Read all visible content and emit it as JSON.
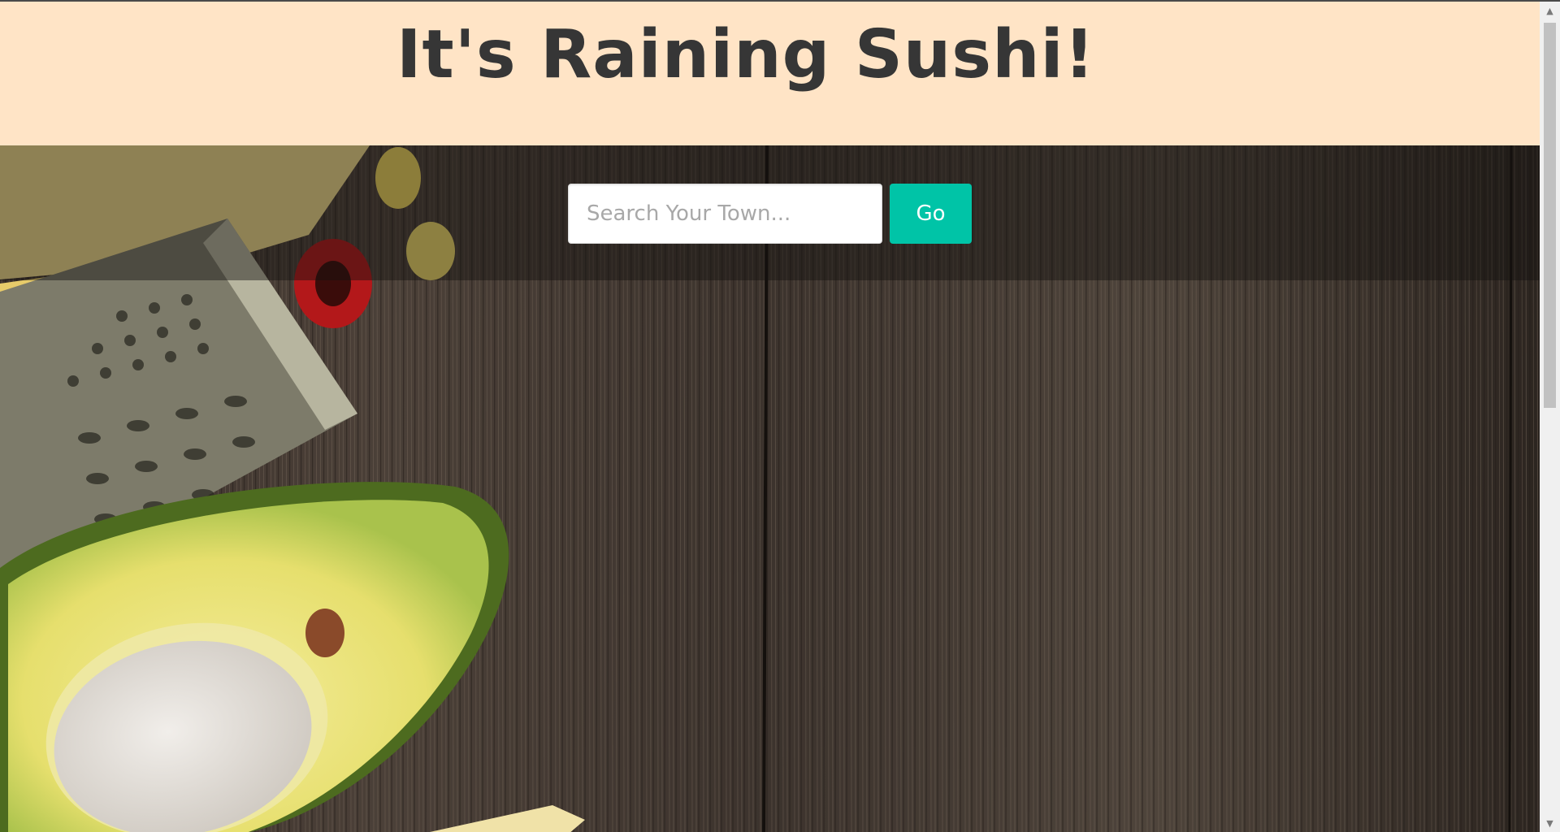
{
  "header": {
    "title": "It's Raining Sushi!"
  },
  "search": {
    "placeholder": "Search Your Town...",
    "value": "",
    "button_label": "Go"
  },
  "scrollbar": {
    "up_arrow": "▲",
    "down_arrow": "▼"
  },
  "background": {
    "description_icons": [
      "cheese-icon",
      "corn-icon",
      "grater-icon",
      "chili-pepper-icon",
      "avocado-icon"
    ]
  },
  "colors": {
    "header_bg": "#ffe4c6",
    "title_text": "#363636",
    "button_bg": "#00c4a7",
    "button_text": "#ffffff",
    "wood": "#3e342d"
  }
}
